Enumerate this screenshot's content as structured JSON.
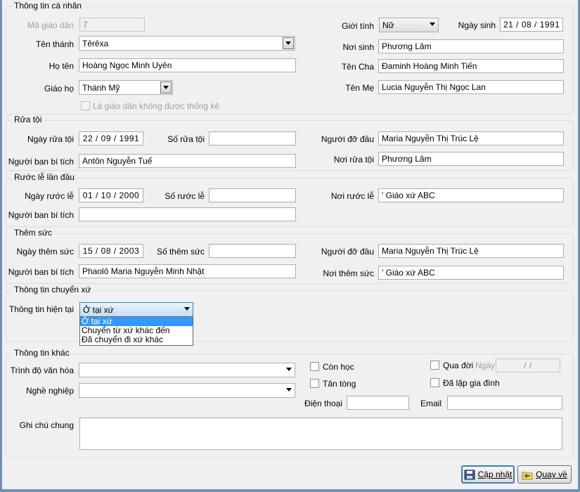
{
  "personal": {
    "title": "Thông tin cá nhân",
    "ma_giao_dan_label": "Mã giáo dân",
    "ma_giao_dan_value": "7",
    "ten_thanh_label": "Tên thánh",
    "ten_thanh_value": "Têrêxa",
    "ho_ten_label": "Họ tên",
    "ho_ten_value": "Hoàng Ngọc Minh Uyên",
    "giao_ho_label": "Giáo họ",
    "giao_ho_value": "Thánh Mỹ",
    "not_counted_label": "Là giáo dân không được thống kê",
    "gioi_tinh_label": "Giới tính",
    "gioi_tinh_value": "Nữ",
    "ngay_sinh_label": "Ngày sinh",
    "ngay_sinh_value": "21 / 08 / 1991",
    "noi_sinh_label": "Nơi sinh",
    "noi_sinh_value": "Phương Lâm",
    "ten_cha_label": "Tên Cha",
    "ten_cha_value": "Đaminh Hoàng Minh Tiến",
    "ten_me_label": "Tên Mẹ",
    "ten_me_value": "Lucia Nguyễn Thị Ngọc Lan"
  },
  "baptism": {
    "title": "Rửa tội",
    "ngay_label": "Ngày rửa tội",
    "ngay_value": "22 / 09 / 1991",
    "so_label": "Số rửa tội",
    "so_value": "",
    "nguoi_do_dau_label": "Người đỡ đầu",
    "nguoi_do_dau_value": "Maria Nguyễn Thị Trúc Lệ",
    "nguoi_ban_label": "Người ban bí tích",
    "nguoi_ban_value": "Antôn Nguyễn Tuế",
    "noi_label": "Nơi rửa tội",
    "noi_value": "Phương Lâm"
  },
  "communion": {
    "title": "Rước lễ lần đầu",
    "ngay_label": "Ngày rước lễ",
    "ngay_value": "01 / 10 / 2000",
    "so_label": "Số rước lễ",
    "so_value": "",
    "noi_label": "Nơi rước lễ",
    "noi_value": "' Giáo xứ ABC",
    "nguoi_ban_label": "Người ban bí tích",
    "nguoi_ban_value": ""
  },
  "confirmation": {
    "title": "Thêm sức",
    "ngay_label": "Ngày thêm sức",
    "ngay_value": "15 / 08 / 2003",
    "so_label": "Số thêm sức",
    "so_value": "",
    "nguoi_do_dau_label": "Người đỡ đầu",
    "nguoi_do_dau_value": "Maria Nguyễn Thị Trúc Lệ",
    "nguoi_ban_label": "Người ban bí tích",
    "nguoi_ban_value": "Phaolô Maria Nguyễn Minh Nhật",
    "noi_label": "Nơi thêm sức",
    "noi_value": "' Giáo xứ ABC"
  },
  "parish": {
    "title": "Thông tin chuyển xứ",
    "current_label": "Thông tin hiện tại",
    "current_value": "Ở tại xứ",
    "options": [
      "Ở tại xứ",
      "Chuyển từ xứ khác đến",
      "Đã chuyển đi xứ khác"
    ]
  },
  "other": {
    "title": "Thông tin khác",
    "trinh_do_label": "Trình độ văn hóa",
    "trinh_do_value": "",
    "nghe_nghiep_label": "Nghề nghiệp",
    "nghe_nghiep_value": "",
    "con_hoc_label": "Còn học",
    "tan_tong_label": "Tân tòng",
    "qua_doi_label": "Qua đời",
    "ngay_label": "Ngày",
    "ngay_value": "/     /",
    "da_lap_gia_dinh_label": "Đã lập gia đình",
    "dien_thoai_label": "Điện thoại",
    "dien_thoai_value": "",
    "email_label": "Email",
    "email_value": "",
    "ghi_chu_label": "Ghi chú chung",
    "ghi_chu_value": ""
  },
  "actions": {
    "update_label": "Cập nhật",
    "back_label": "Quay về"
  },
  "colors": {
    "selection": "#3399ff",
    "border_blue": "#3c7fb1"
  }
}
